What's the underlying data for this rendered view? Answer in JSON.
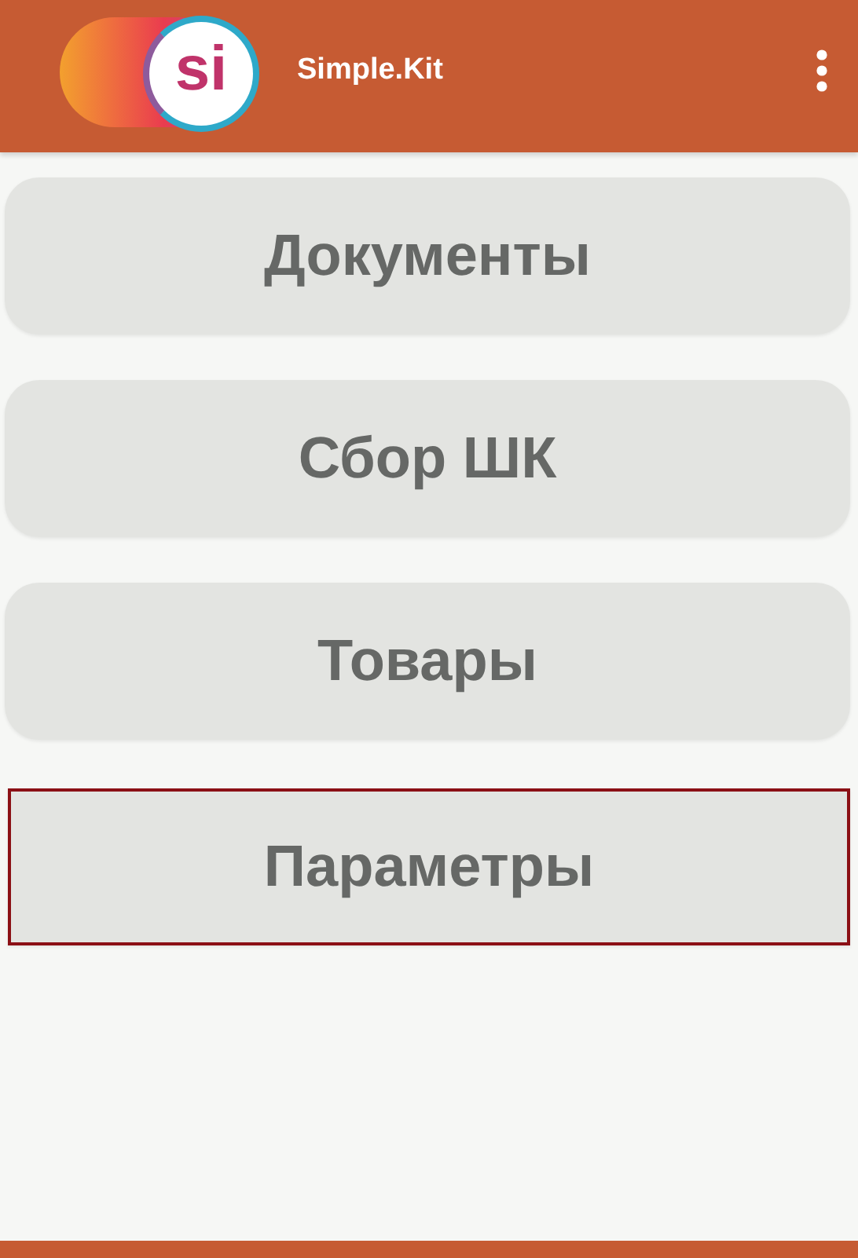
{
  "app_bar": {
    "logo_text": "si",
    "title": "Simple.Kit"
  },
  "menu": [
    {
      "label": "Документы",
      "selected": false
    },
    {
      "label": "Сбор ШК",
      "selected": false
    },
    {
      "label": "Товары",
      "selected": false
    },
    {
      "label": "Параметры",
      "selected": true
    }
  ]
}
